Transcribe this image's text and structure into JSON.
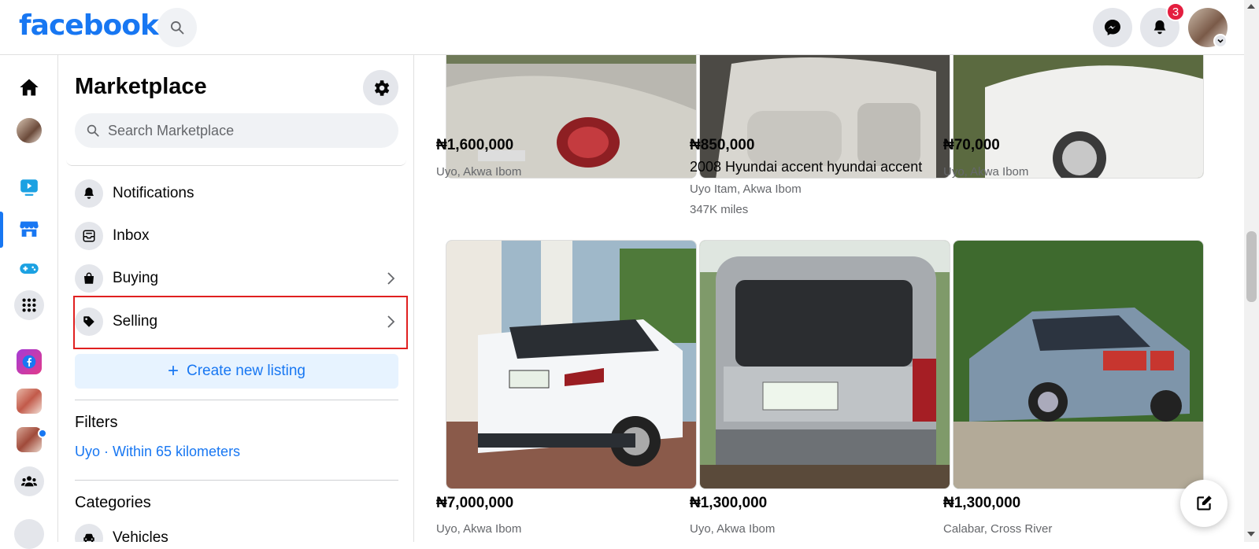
{
  "header": {
    "logo": "facebook",
    "notifications_badge": "3"
  },
  "sidebar": {
    "title": "Marketplace",
    "search_placeholder": "Search Marketplace",
    "items": [
      {
        "label": "Notifications",
        "icon": "bell-icon"
      },
      {
        "label": "Inbox",
        "icon": "inbox-icon"
      },
      {
        "label": "Buying",
        "icon": "shopping-bag-icon"
      },
      {
        "label": "Selling",
        "icon": "price-tag-icon"
      }
    ],
    "create_listing": "Create new listing",
    "filters_title": "Filters",
    "filter_location": "Uyo · Within 65 kilometers",
    "categories_title": "Categories",
    "first_category": "Vehicles"
  },
  "listings": [
    {
      "price": "₦1,600,000",
      "title": "",
      "location": "Uyo, Akwa Ibom",
      "extra": ""
    },
    {
      "price": "₦850,000",
      "title": "2008 Hyundai accent hyundai accent",
      "location": "Uyo Itam, Akwa Ibom",
      "extra": "347K miles"
    },
    {
      "price": "₦70,000",
      "title": "",
      "location": "Uyo, Akwa Ibom",
      "extra": ""
    },
    {
      "price": "₦7,000,000",
      "title": "",
      "location": "Uyo, Akwa Ibom",
      "extra": ""
    },
    {
      "price": "₦1,300,000",
      "title": "",
      "location": "Uyo, Akwa Ibom",
      "extra": ""
    },
    {
      "price": "₦1,300,000",
      "title": "",
      "location": "Calabar, Cross River",
      "extra": ""
    }
  ],
  "colors": {
    "brand": "#1877f2",
    "badge": "#e41e3f",
    "highlight_box": "#e02020"
  }
}
